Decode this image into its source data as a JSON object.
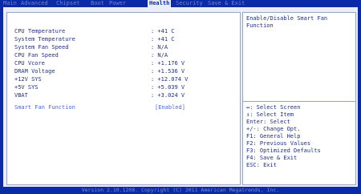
{
  "menu": {
    "tabs": [
      "Main",
      "Advanced",
      "Chipset",
      "Boot",
      "Power",
      "Health",
      "Security",
      "Save & Exit"
    ]
  },
  "health": {
    "rows": [
      {
        "label": "CPU Temperature",
        "value": ": +41 C"
      },
      {
        "label": "System Temperature",
        "value": ": +41 C"
      },
      {
        "label": "System Fan Speed",
        "value": ": N/A"
      },
      {
        "label": "CPU Fan Speed",
        "value": ": N/A"
      },
      {
        "label": "CPU Vcore",
        "value": ": +1.176 V"
      },
      {
        "label": "DRAM Voltage",
        "value": ": +1.536 V"
      },
      {
        "label": "+12V SYS",
        "value": ": +12.074 V"
      },
      {
        "label": "+5V SYS",
        "value": ": +5.039 V"
      },
      {
        "label": "VBAT",
        "value": ": +3.024 V"
      }
    ],
    "smart_fan": {
      "label": "Smart Fan Function",
      "value": "[Enabled]"
    }
  },
  "help": {
    "title": "Enable/Disable Smart Fan Function",
    "keys": [
      "↔: Select Screen",
      "↕: Select Item",
      "Enter: Select",
      "+/-: Change Opt.",
      "F1: General Help",
      "F2: Previous Values",
      "F3: Optimized Defaults",
      "F4: Save & Exit",
      "ESC: Exit"
    ]
  },
  "footer": {
    "text": "Version 2.10.1208. Copyright (C) 2011 American Megatrends, Inc."
  },
  "colors": {
    "frame_blue": "#0b2aa8",
    "panel": "#e9eef8",
    "text_blue": "#1f2f8a",
    "active_tab_bg": "#e8eef8",
    "inactive_tab": "#6f86c8"
  }
}
